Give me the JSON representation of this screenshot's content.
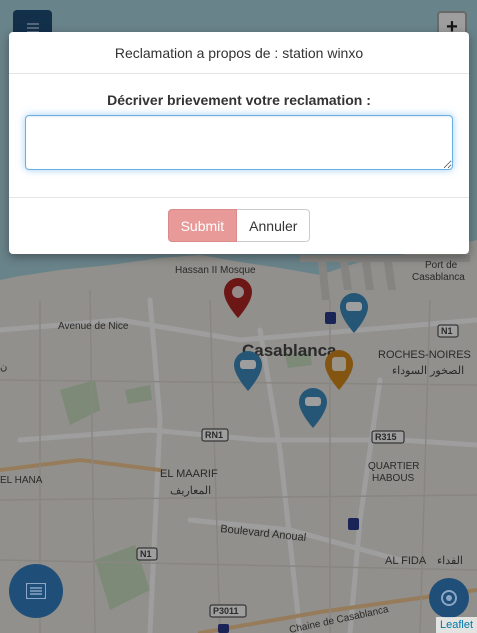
{
  "modal": {
    "title": "Reclamation a propos de : station winxo",
    "label": "Décriver brievement votre reclamation :",
    "textarea_value": "",
    "submit_label": "Submit",
    "cancel_label": "Annuler"
  },
  "map": {
    "city_label": "Casablanca",
    "place_labels": {
      "mosque": "Hassan II Mosque",
      "avenue_nice": "Avenue de Nice",
      "port": "Port de",
      "port2": "Casablanca",
      "roches": "ROCHES-NOIRES",
      "roches_ar": "الصخور السوداء",
      "maarif": "EL MAARIF",
      "maarif_ar": "المعاريف",
      "habous": "QUARTIER",
      "habous2": "HABOUS",
      "hana": "EL HANA",
      "boulevard": "Boulevard Anoual",
      "fida": "AL FIDA",
      "fida_ar": "الفداء",
      "chaine": "Chaine de Casablanca",
      "left_partial": "ن"
    },
    "road_shields": {
      "n1_top": "N1",
      "rn1": "RN1",
      "r315": "R315",
      "n1_bottom": "N1",
      "p3011": "P3011"
    },
    "attribution": "Leaflet"
  },
  "icons": {
    "menu": "menu-icon",
    "zoom": "+",
    "list": "list-icon",
    "locate": "locate-icon"
  },
  "colors": {
    "primary": "#1f4e79",
    "marker_blue": "#3d8bbf",
    "marker_red": "#b02424",
    "marker_orange": "#d48a1a",
    "submit_disabled": "#e89a98"
  }
}
